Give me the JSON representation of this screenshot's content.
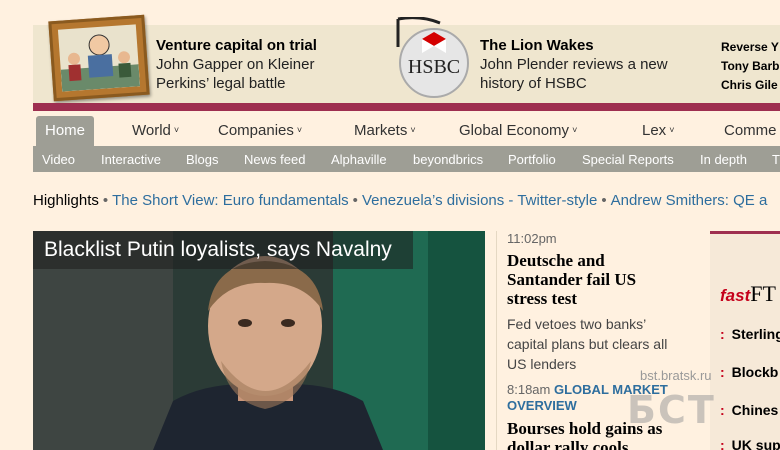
{
  "promo": {
    "card1": {
      "title": "Venture capital on trial",
      "line1": "John Gapper on Kleiner",
      "line2": "Perkins’ legal battle"
    },
    "card2": {
      "logo": "HSBC",
      "title": "The Lion Wakes",
      "line1": "John Plender reviews a new",
      "line2": "history of HSBC"
    },
    "card3": {
      "line1": "Reverse Y",
      "line2": "Tony Barb",
      "line3": "Chris Gile"
    }
  },
  "mainnav": {
    "home": "Home",
    "items": [
      "World",
      "Companies",
      "Markets",
      "Global Economy",
      "Lex",
      "Comme"
    ],
    "chevron": "˅"
  },
  "subnav": {
    "items": [
      "Video",
      "Interactive",
      "Blogs",
      "News feed",
      "Alphaville",
      "beyondbrics",
      "Portfolio",
      "Special Reports",
      "In depth",
      "T"
    ]
  },
  "highlights": {
    "label": "Highlights",
    "links": [
      "The Short View: Euro fundamentals",
      "Venezuela’s divisions - Twitter-style",
      "Andrew Smithers: QE a"
    ]
  },
  "lead": {
    "title": "Blacklist Putin loyalists, says Navalny"
  },
  "midcol": {
    "story1": {
      "time": "11:02pm",
      "headline": "Deutsche and Santander fail US stress test",
      "summary": "Fed vetoes two banks’ capital plans but clears all US lenders"
    },
    "story2": {
      "time": "8:18am",
      "section": "GLOBAL MARKET OVERVIEW",
      "headline": "Bourses hold gains as dollar rally cools"
    }
  },
  "fastft": {
    "fast": "fast",
    "ft": "FT",
    "items": [
      "Sterling",
      "Blockb",
      "Chines",
      "UK sup"
    ]
  },
  "watermark": {
    "site": "bst.bratsk.ru",
    "logo": "БСТ"
  },
  "colors": {
    "background": "#fff1e0",
    "maroon": "#9e2f50",
    "link": "#2e6e9e",
    "nav_grey": "#9e9e95"
  }
}
